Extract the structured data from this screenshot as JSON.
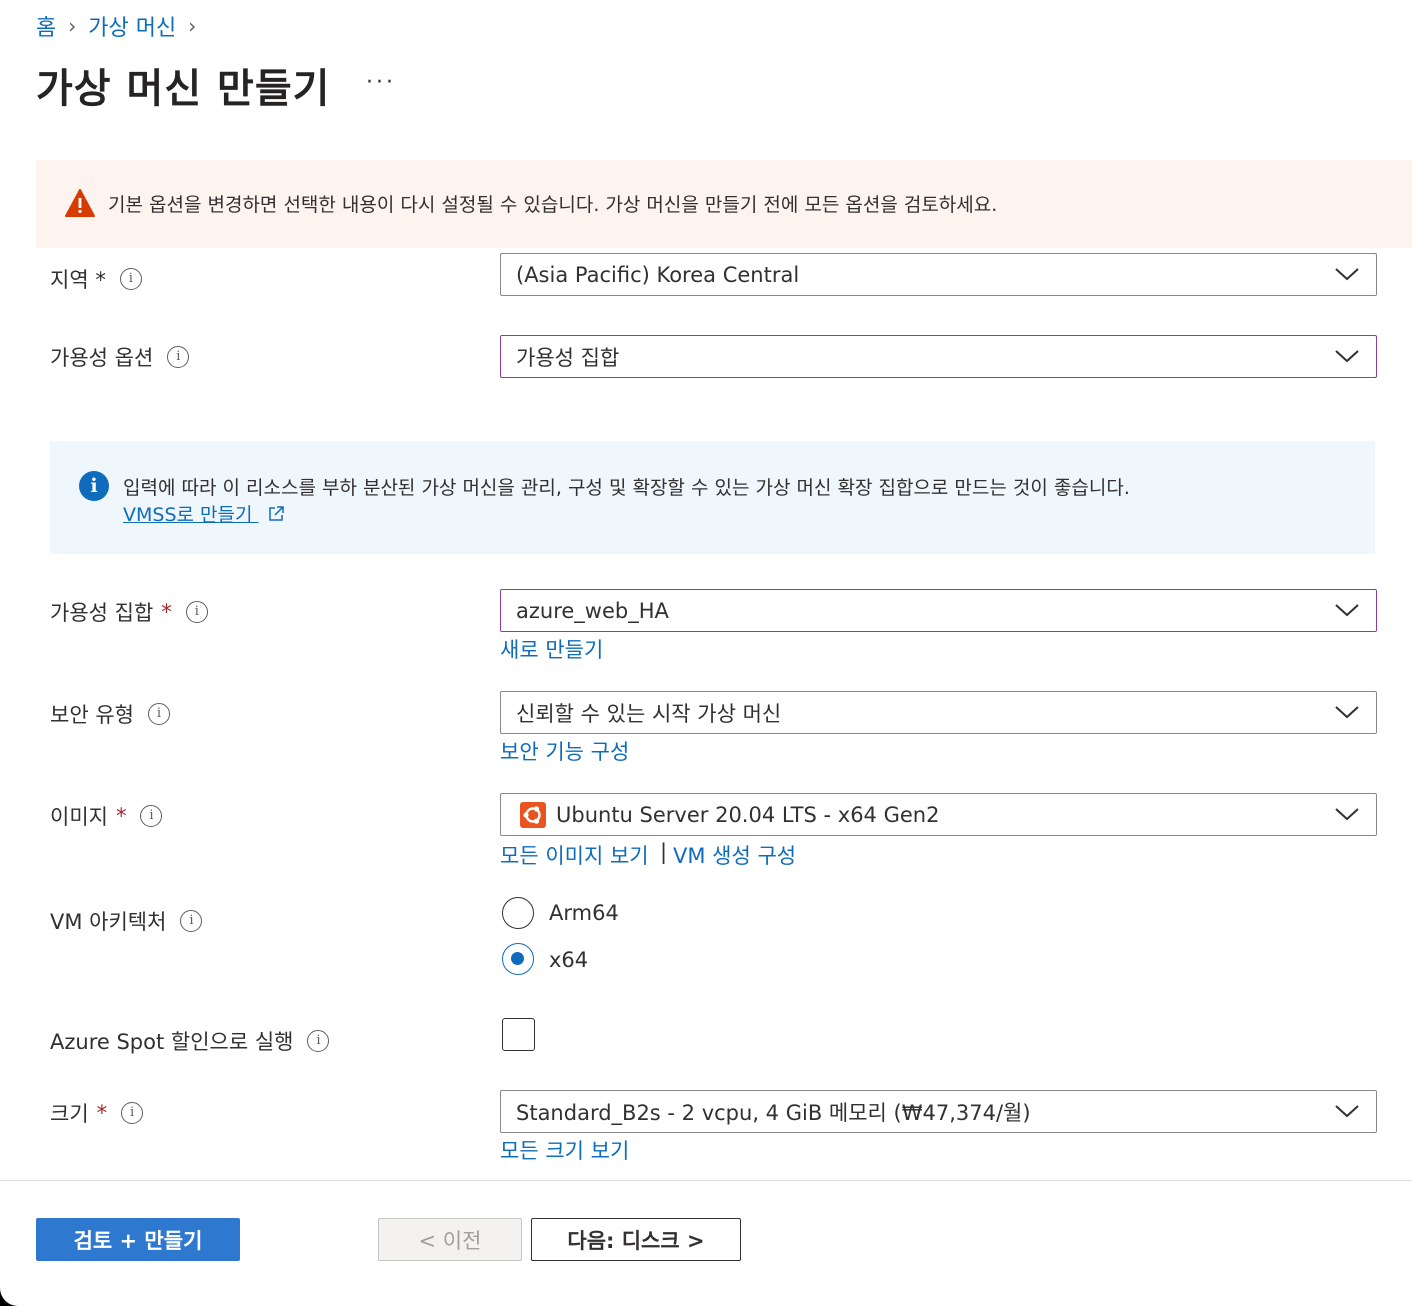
{
  "breadcrumb": {
    "home": "홈",
    "vm": "가상 머신"
  },
  "page": {
    "title": "가상 머신 만들기",
    "more": "···"
  },
  "warning": {
    "text": "기본 옵션을 변경하면 선택한 내용이 다시 설정될 수 있습니다. 가상 머신을 만들기 전에 모든 옵션을 검토하세요."
  },
  "region": {
    "label": "지역 *",
    "value": "(Asia Pacific) Korea Central"
  },
  "availability_option": {
    "label": "가용성 옵션",
    "value": "가용성 집합"
  },
  "info_box": {
    "text": "입력에 따라 이 리소스를 부하 분산된 가상 머신을 관리, 구성 및 확장할 수 있는 가상 머신 확장 집합으로 만드는 것이 좋습니다.",
    "link": "VMSS로 만들기"
  },
  "availability_set": {
    "label": "가용성 집합",
    "required": "*",
    "value": "azure_web_HA",
    "create_new": "새로 만들기"
  },
  "security_type": {
    "label": "보안 유형",
    "value": "신뢰할 수 있는 시작 가상 머신",
    "configure_link": "보안 기능 구성"
  },
  "image": {
    "label": "이미지",
    "required": "*",
    "value": "Ubuntu Server 20.04 LTS - x64 Gen2",
    "see_all": "모든 이미지 보기",
    "separator": "|",
    "configure_vm": "VM 생성 구성"
  },
  "vm_architecture": {
    "label": "VM 아키텍처",
    "options": [
      "Arm64",
      "x64"
    ],
    "selected": "x64"
  },
  "spot": {
    "label": "Azure Spot 할인으로 실행",
    "checked": false
  },
  "size": {
    "label": "크기",
    "required": "*",
    "value": "Standard_B2s - 2 vcpu, 4 GiB 메모리 (₩47,374/월)",
    "see_all": "모든 크기 보기"
  },
  "footer": {
    "review_create": "검토 + 만들기",
    "previous": "< 이전",
    "next": "다음: 디스크 >"
  },
  "colors": {
    "accent": "#0f6cbd",
    "primary_button": "#2f78d0",
    "warning_bg": "#fdf3ef",
    "warning_icon": "#d83b01",
    "info_bg": "#eff6fc",
    "focus_border": "#8a3ea0",
    "required": "#a4262c",
    "ubuntu": "#e95420"
  }
}
